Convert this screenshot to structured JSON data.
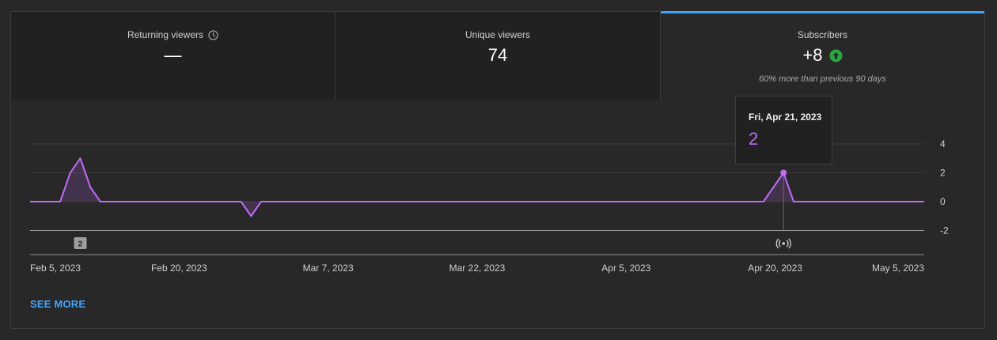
{
  "metrics": [
    {
      "label": "Returning viewers",
      "value": "—",
      "icon": "clock-icon"
    },
    {
      "label": "Unique viewers",
      "value": "74"
    },
    {
      "label": "Subscribers",
      "value": "+8",
      "icon": "arrow-up-icon",
      "note": "60% more than previous 90 days",
      "selected": true
    }
  ],
  "colors": {
    "line": "#bf6bf5",
    "accent": "#3ea6ff",
    "up": "#2ba640"
  },
  "tooltip": {
    "date": "Fri, Apr 21, 2023",
    "value": "2"
  },
  "markers": [
    {
      "text": "2",
      "date": "2023-02-10"
    },
    {
      "icon": "live-broadcast-icon",
      "date": "2023-04-21"
    }
  ],
  "see_more": "SEE MORE",
  "chart_data": {
    "type": "line",
    "x_ticks": [
      "Feb 5, 2023",
      "Feb 20, 2023",
      "Mar 7, 2023",
      "Mar 22, 2023",
      "Apr 5, 2023",
      "Apr 20, 2023",
      "May 5, 2023"
    ],
    "y_ticks": [
      4,
      2,
      0,
      -2
    ],
    "ylim": [
      -2,
      4
    ],
    "xlim": [
      "2023-02-05",
      "2023-05-05"
    ],
    "series": [
      {
        "points": [
          [
            "2023-02-05",
            0
          ],
          [
            "2023-02-08",
            0
          ],
          [
            "2023-02-09",
            2
          ],
          [
            "2023-02-10",
            3
          ],
          [
            "2023-02-11",
            1
          ],
          [
            "2023-02-12",
            0
          ],
          [
            "2023-02-26",
            0
          ],
          [
            "2023-02-27",
            -1
          ],
          [
            "2023-02-28",
            0
          ],
          [
            "2023-04-19",
            0
          ],
          [
            "2023-04-21",
            2
          ],
          [
            "2023-04-22",
            0
          ],
          [
            "2023-05-05",
            0
          ]
        ]
      }
    ],
    "highlight": {
      "date": "2023-04-21",
      "value": 2
    }
  }
}
